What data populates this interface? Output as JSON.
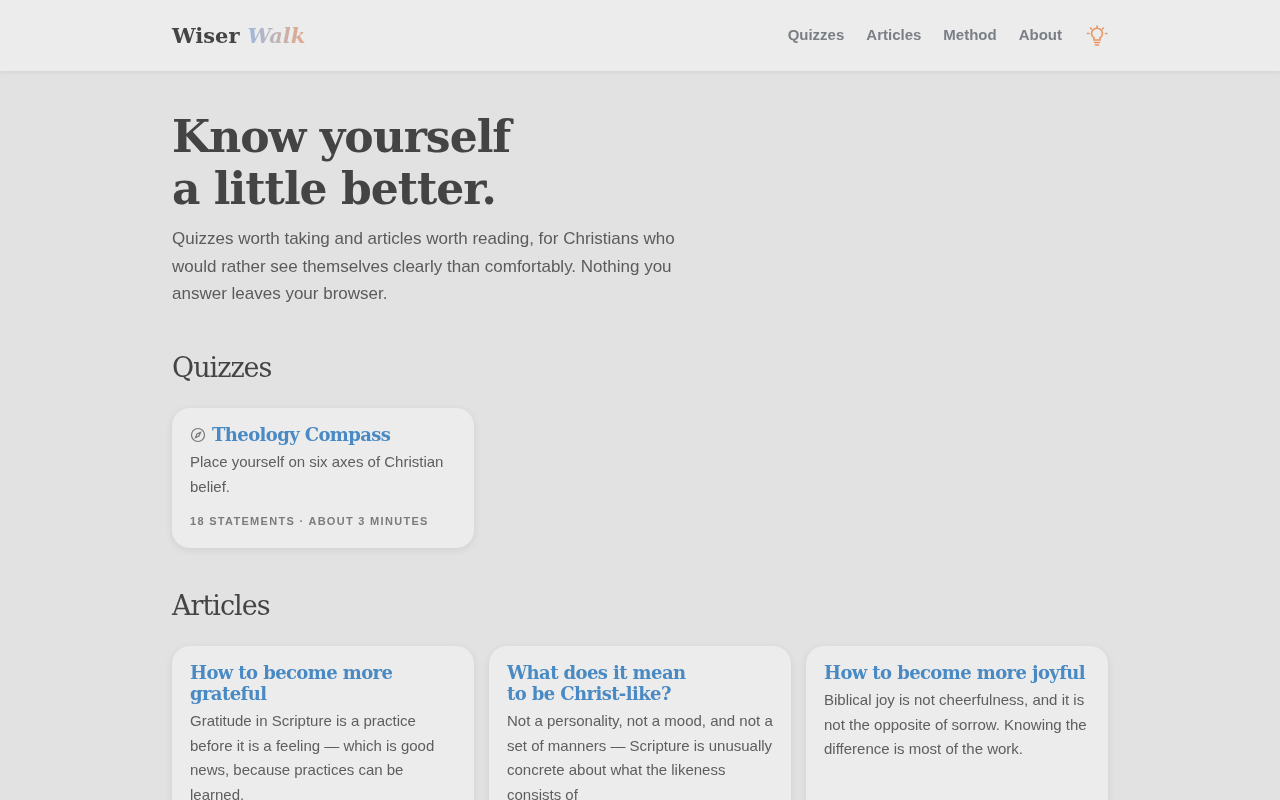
{
  "header": {
    "logo": [
      "Wiser",
      "Walk"
    ],
    "nav": [
      "Quizzes",
      "Articles",
      "Method",
      "About"
    ]
  },
  "hero": {
    "title_lines": [
      "Know yourself",
      "a little better."
    ],
    "intro": "Quizzes worth taking and articles worth reading, for Christians who would rather see themselves clearly than comfortably. Nothing you answer leaves your browser."
  },
  "quizzes": {
    "heading": "Quizzes",
    "cards": [
      {
        "title": "Theology Compass",
        "description": "Place yourself on six axes of Christian belief.",
        "meta": "18 STATEMENTS · ABOUT 3 MINUTES"
      }
    ]
  },
  "articles": {
    "heading": "Articles",
    "cards": [
      {
        "title": "How to become more grateful",
        "description": "Gratitude in Scripture is a practice before it is a feeling — which is good news, because practices can be learned."
      },
      {
        "title": "What does it mean\nto be Christ-like?",
        "description": "Not a personality, not a mood, and not a set of manners — Scripture is unusually concrete about what the likeness consists of"
      },
      {
        "title": "How to become more joyful",
        "description": "Biblical joy is not cheerfulness, and it is not the opposite of sorrow. Knowing the difference is most of the work."
      }
    ]
  }
}
